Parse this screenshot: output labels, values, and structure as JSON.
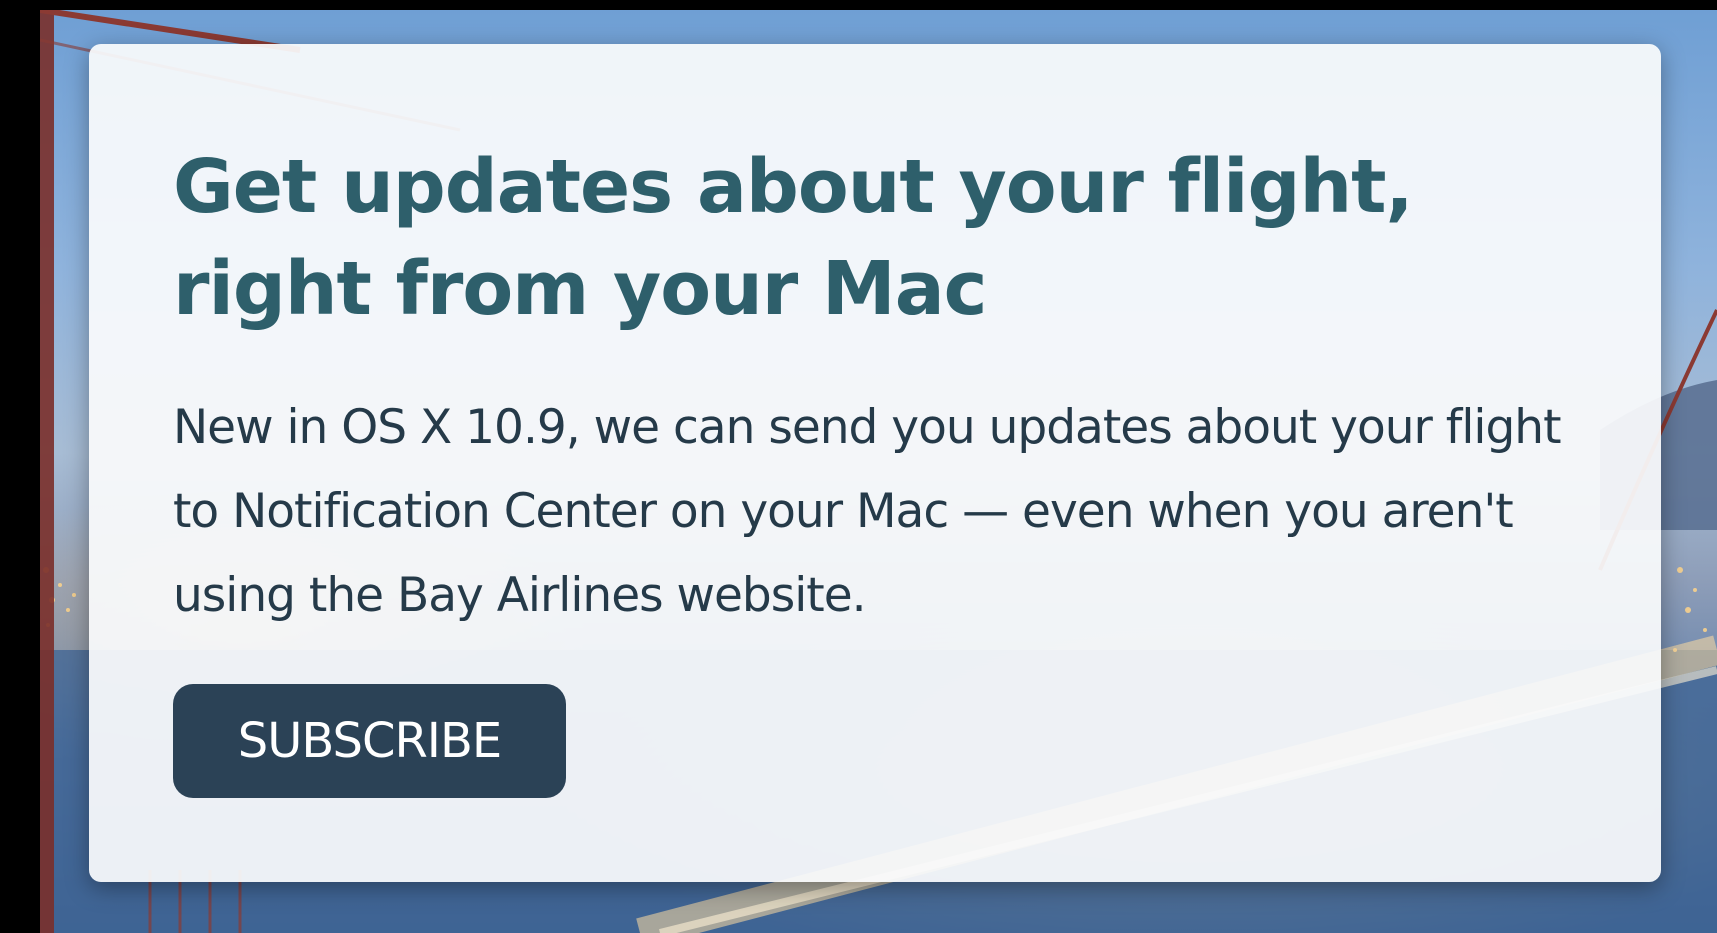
{
  "card": {
    "headline": "Get updates about your flight, right from your Mac",
    "body": "New in OS X 10.9, we can send you updates about your flight to Notification Center on your Mac — even when you aren't using the Bay Airlines website.",
    "subscribe_label": "SUBSCRIBE"
  },
  "colors": {
    "headline": "#2e5f6b",
    "body_text": "#253a49",
    "button_bg": "#2b4256",
    "button_text": "#ffffff",
    "card_bg": "#fafbfc",
    "page_bg": "#000000"
  },
  "background": {
    "image": "bridge-photo"
  }
}
